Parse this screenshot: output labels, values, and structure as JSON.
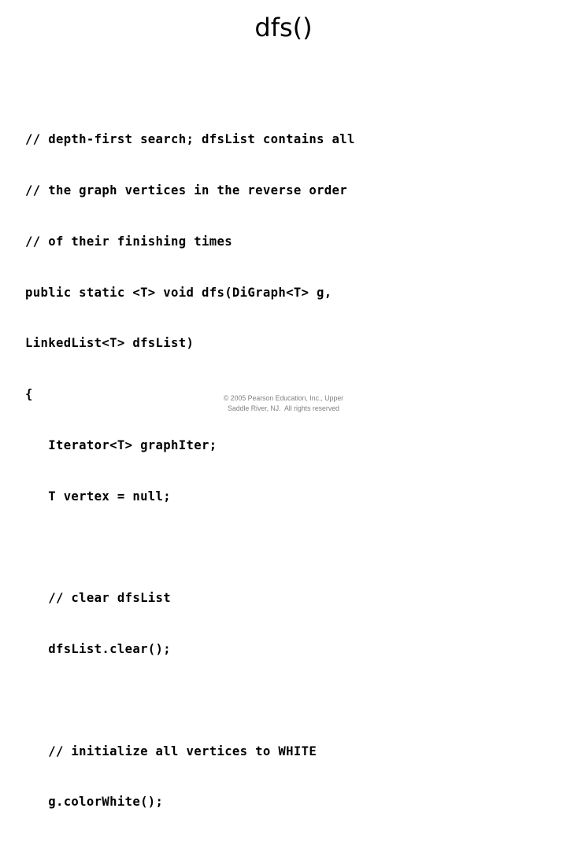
{
  "slide": {
    "title": "dfs()",
    "background_color": "#ffffff",
    "text_color": "#000000"
  },
  "code": {
    "language": "java",
    "lines": [
      "// depth-first search; dfsList contains all",
      "// the graph vertices in the reverse order",
      "// of their finishing times",
      "public static <T> void dfs(DiGraph<T> g,",
      "LinkedList<T> dfsList)",
      "{",
      "   Iterator<T> graphIter;",
      "   T vertex = null;",
      "",
      "   // clear dfsList",
      "   dfsList.clear();",
      "",
      "   // initialize all vertices to WHITE",
      "   g.colorWhite();"
    ]
  },
  "footer": {
    "color": "#808080",
    "line1": "© 2005 Pearson Education, Inc., Upper",
    "line2": "Saddle River, NJ.  All rights reserved"
  }
}
